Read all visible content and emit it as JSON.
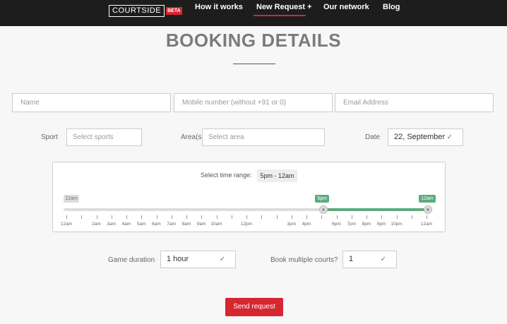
{
  "nav": {
    "logo_text": "COURTSIDE",
    "logo_badge": "BETA",
    "items": [
      {
        "label": "How it works"
      },
      {
        "label": "New Request +"
      },
      {
        "label": "Our network"
      },
      {
        "label": "Blog"
      }
    ],
    "active_index": 1
  },
  "page": {
    "title": "BOOKING DETAILS"
  },
  "contact": {
    "name_placeholder": "Name",
    "mobile_placeholder": "Mobile number (without +91 or 0)",
    "email_placeholder": "Email Address"
  },
  "filters": {
    "sport_label": "Sport",
    "sport_placeholder": "Select sports",
    "area_label": "Area(s)",
    "area_placeholder": "Select area",
    "date_label": "Date",
    "date_value": "22, September"
  },
  "time_range": {
    "label": "Select time range:",
    "value": "5pm - 12am",
    "min_badge": "12am",
    "from_badge": "5pm",
    "to_badge": "12am",
    "selected_from_hour": 17,
    "selected_to_hour": 24,
    "tick_labels": [
      "12am",
      "2am",
      "3am",
      "4am",
      "5am",
      "6am",
      "7am",
      "8am",
      "9am",
      "10am",
      "12pm",
      "3pm",
      "4pm",
      "6pm",
      "7pm",
      "8pm",
      "9pm",
      "10pm",
      "12am"
    ],
    "accent_color": "#5bab7e"
  },
  "options": {
    "duration_label": "Game duration",
    "duration_value": "1 hour",
    "courts_label": "Book multiple courts?",
    "courts_value": "1"
  },
  "submit_label": "Send request",
  "colors": {
    "brand_red": "#d6262f",
    "topbar": "#1d1d1d"
  },
  "icons": [
    "check-icon"
  ]
}
